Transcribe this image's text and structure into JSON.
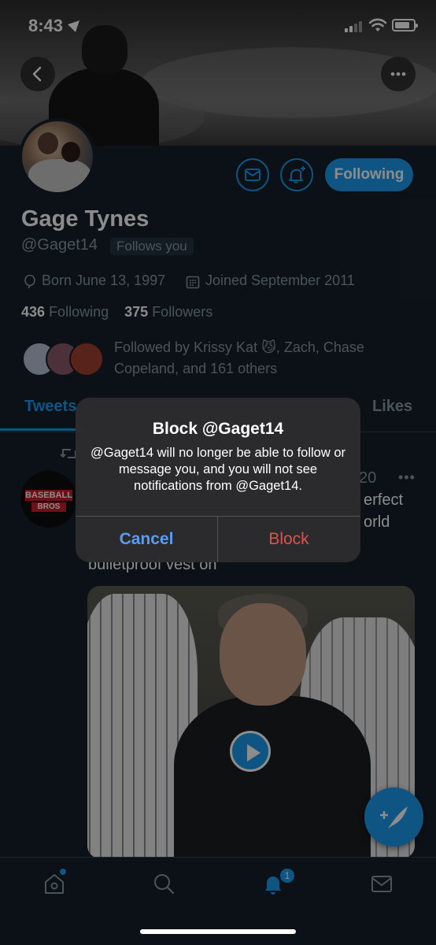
{
  "status_bar": {
    "time": "8:43"
  },
  "profile": {
    "name": "Gage Tynes",
    "handle": "@Gaget14",
    "follows_you": "Follows you",
    "born": "Born June 13, 1997",
    "joined": "Joined September 2011",
    "following_count": "436",
    "following_label": "Following",
    "followers_count": "375",
    "followers_label": "Followers",
    "followed_by": "Followed by Krissy Kat 😼, Zach, Chase Copeland, and 161 others",
    "following_button": "Following"
  },
  "tabs": [
    {
      "label": "Tweets"
    },
    {
      "label": "Likes"
    }
  ],
  "tweet": {
    "date_fragment": "20",
    "more": "•••",
    "text_fragment_1": "erfect",
    "text_fragment_2": "orld",
    "text_fragment_3": "bulletproof vest on",
    "avatar_text_1": "BASEBALL",
    "avatar_text_2": "BROS"
  },
  "bottom_nav": {
    "notification_count": "1"
  },
  "alert": {
    "title": "Block @Gaget14",
    "message": "@Gaget14 will no longer be able to follow or message you, and you will not see notifications from @Gaget14.",
    "cancel_label": "Cancel",
    "block_label": "Block"
  },
  "colors": {
    "background": "#15202b",
    "accent": "#1d9bf0",
    "muted_text": "#8899a6",
    "destructive": "#e2504a",
    "alert_bg": "#2c2c2e"
  },
  "icons": [
    "location-arrow-icon",
    "cellular-signal-icon",
    "wifi-icon",
    "battery-icon",
    "back-arrow-icon",
    "more-icon",
    "mail-icon",
    "bell-plus-icon",
    "birthday-balloon-icon",
    "calendar-icon",
    "retweet-icon",
    "play-icon",
    "compose-icon",
    "home-icon",
    "search-icon",
    "notifications-bell-icon",
    "messages-mail-icon"
  ]
}
